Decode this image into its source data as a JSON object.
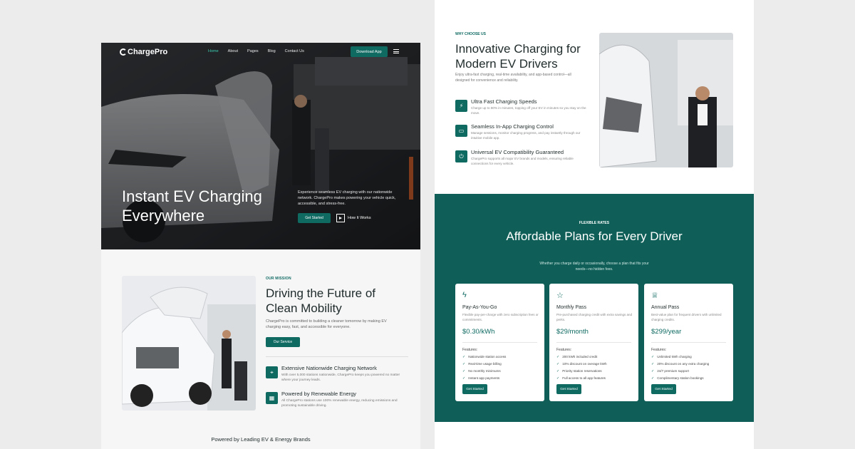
{
  "left": {
    "logo": "ChargePro",
    "nav": [
      "Home",
      "About",
      "Pages",
      "Blog",
      "Contact Us"
    ],
    "download_btn": "Download App",
    "hero_title": "Instant EV Charging Everywhere",
    "hero_desc": "Experience seamless EV charging with our nationwide network. ChargePro makes powering your vehicle quick, accessible, and stress-free.",
    "get_started": "Get Started",
    "how_it_works": "How It Works",
    "mission_kicker": "OUR MISSION",
    "mission_title": "Driving the Future of Clean Mobility",
    "mission_desc": "ChargePro is committed to building a cleaner tomorrow by making EV charging easy, fast, and accessible for everyone.",
    "our_service": "Our Service",
    "features": [
      {
        "title": "Extensive Nationwide Charging Network",
        "desc": "With over 5,000 stations nationwide, ChargePro keeps you powered no matter where your journey leads."
      },
      {
        "title": "Powered by Renewable Energy",
        "desc": "All ChargePro stations use 100% renewable energy, reducing emissions and promoting sustainable driving."
      }
    ],
    "brands": "Powered by Leading EV & Energy Brands"
  },
  "right": {
    "why_kicker": "WHY CHOOSE US",
    "why_title": "Innovative Charging for Modern EV Drivers",
    "why_desc": "Enjoy ultra-fast charging, real-time availability, and app-based control—all designed for convenience and reliability.",
    "features": [
      {
        "title": "Ultra Fast Charging Speeds",
        "desc": "Charge up to 80% in minutes, topping off your EV in minutes so you stay on the move."
      },
      {
        "title": "Seamless In-App Charging Control",
        "desc": "Manage sessions, monitor charging progress, and pay instantly through our intuitive mobile app."
      },
      {
        "title": "Universal EV Compatibility Guaranteed",
        "desc": "ChargePro supports all major EV brands and models, ensuring reliable connections for every vehicle."
      }
    ],
    "pricing_kicker": "FLEXIBLE RATES",
    "pricing_title": "Affordable Plans for Every Driver",
    "pricing_desc": "Whether you charge daily or occasionally, choose a plan that fits your needs—no hidden fees.",
    "features_label": "Features:",
    "plans": [
      {
        "name": "Pay-As-You-Go",
        "desc": "Flexible pay-per-charge with zero subscription fees or commitments.",
        "price": "$0.30/kWh",
        "features": [
          "Nationwide station access",
          "Real-time usage billing",
          "No monthly minimums",
          "Instant app payments"
        ],
        "button": "Get Started",
        "icon": "bolt-icon"
      },
      {
        "name": "Monthly Pass",
        "desc": "Pre-purchased charging credit with extra savings and perks.",
        "price": "$29/month",
        "features": [
          "200 kWh included credit",
          "10% discount on overage kWh",
          "Priority station reservations",
          "Full access to all app features"
        ],
        "button": "Get Started",
        "icon": "star-badge-icon"
      },
      {
        "name": "Annual Pass",
        "desc": "Best-value plan for frequent drivers with unlimited charging credits.",
        "price": "$299/year",
        "features": [
          "Unlimited kWh charging",
          "20% discount on any extra charging",
          "24/7 premium support",
          "Complimentary station bookings"
        ],
        "button": "Get Started",
        "icon": "trophy-icon"
      }
    ]
  },
  "colors": {
    "brand": "#0f6a62",
    "pricing_bg": "#0f5f58",
    "accent_link": "#3ccbb0"
  }
}
